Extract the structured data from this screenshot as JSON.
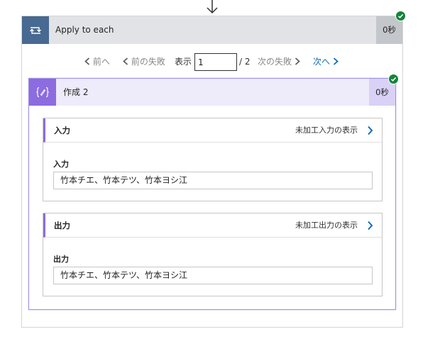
{
  "loop": {
    "title": "Apply to each",
    "duration": "0秒",
    "icon": "loop-icon",
    "status": "succeeded"
  },
  "pager": {
    "prev": "前へ",
    "prev_failed": "前の失敗",
    "show_label": "表示",
    "current_page": "1",
    "total": "/ 2",
    "next_failed": "次の失敗",
    "next": "次へ"
  },
  "compose": {
    "title": "作成 2",
    "duration": "0秒",
    "icon": "compose-icon",
    "status": "succeeded"
  },
  "inputs": {
    "section_title": "入力",
    "raw_link": "未加工入力の表示",
    "field_label": "入力",
    "field_value": "竹本チエ、竹本テツ、竹本ヨシ江"
  },
  "outputs": {
    "section_title": "出力",
    "raw_link": "未加工出力の表示",
    "field_label": "出力",
    "field_value": "竹本チエ、竹本テツ、竹本ヨシ江"
  },
  "colors": {
    "loop_accent": "#486991",
    "compose_accent": "#8c6cdf",
    "success": "#128438",
    "link": "#0f6cbd"
  }
}
